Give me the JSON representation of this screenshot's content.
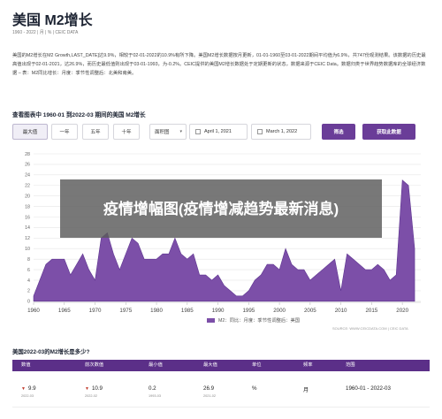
{
  "title": "美国 M2增长",
  "subtitle": "1960 - 2022 | 月 | % | CEIC DATA",
  "description": "美国的M2增长在M2 Growth,LAST_DATE]达9.9%，相较于02-01-2022的10.9%有所下降。美国M2增长数据按月更新，01-01-1960至03-01-2022期间平均值为6.9%，共747份观测结果。该数据的历史最高值出现于02-01-2021，达26.9%，而历史最低值则出现于03-01-1993，为-0.2%。CEIC提供的美国M2增长数据处于定期更新的状态，数据来源于CEIC Data。数据归类于世界趋势数据库的全球经济数据 – 表：M2同比增长：月度：季节性调整后：北美和南美。",
  "section_title": "查看图表中 1960-01 到2022-03 期间的美国 M2增长",
  "controls": {
    "buttons": [
      "最大值",
      "一年",
      "五年",
      "十年"
    ],
    "chart_type": "面积图",
    "start_date": "April 1, 2021",
    "end_date": "March 1, 2022",
    "filter_label": "筛选",
    "download_label": "获取此数据"
  },
  "overlay_text": "疫情增幅图(疫情增减趋势最新消息)",
  "legend_label": "M2：同比：月度：季节性调整后：美国",
  "source_text": "SOURCE: WWW.CEICDATA.COM | CEIC DATA",
  "colors": {
    "accent": "#6a3d98",
    "series": "#7c4fa8",
    "header": "#5b2f88",
    "down": "#c0392b"
  },
  "chart_data": {
    "type": "area",
    "x": [
      1960,
      1961,
      1962,
      1963,
      1964,
      1965,
      1966,
      1967,
      1968,
      1969,
      1970,
      1971,
      1972,
      1973,
      1974,
      1975,
      1976,
      1977,
      1978,
      1979,
      1980,
      1981,
      1982,
      1983,
      1984,
      1985,
      1986,
      1987,
      1988,
      1989,
      1990,
      1991,
      1992,
      1993,
      1994,
      1995,
      1996,
      1997,
      1998,
      1999,
      2000,
      2001,
      2002,
      2003,
      2004,
      2005,
      2006,
      2007,
      2008,
      2009,
      2010,
      2011,
      2012,
      2013,
      2014,
      2015,
      2016,
      2017,
      2018,
      2019,
      2020,
      2021,
      2022
    ],
    "series": [
      {
        "name": "M2：同比：月度：季节性调整后：美国",
        "values": [
          1,
          4,
          7,
          8,
          8,
          8,
          5,
          7,
          9,
          6,
          4,
          12,
          13,
          9,
          6,
          9,
          12,
          11,
          8,
          8,
          8,
          9,
          9,
          12,
          9,
          8,
          9,
          5,
          5,
          4,
          5,
          3,
          2,
          1,
          1,
          2,
          4,
          5,
          7,
          7,
          6,
          10,
          7,
          6,
          6,
          4,
          5,
          6,
          7,
          8,
          2,
          9,
          8,
          7,
          6,
          6,
          7,
          6,
          4,
          5,
          23,
          22,
          10
        ]
      }
    ],
    "x_ticks": [
      "1960",
      "1965",
      "1970",
      "1975",
      "1980",
      "1985",
      "1990",
      "1995",
      "2000",
      "2005",
      "2010",
      "2015",
      "2020"
    ],
    "y_ticks": [
      "0",
      "2",
      "4",
      "6",
      "8",
      "10",
      "12",
      "14",
      "16",
      "18",
      "20",
      "22",
      "24",
      "26",
      "28"
    ],
    "ylim": [
      -0.2,
      28
    ],
    "grid": true
  },
  "table": {
    "title": "美国2022-03的M2增长是多少?",
    "headers": [
      "数值",
      "前次数值",
      "最小值",
      "最大值",
      "单位",
      "频率",
      "范围"
    ],
    "row": {
      "value": "9.9",
      "value_date": "2022-03",
      "prev": "10.9",
      "prev_date": "2022-02",
      "min": "0.2",
      "min_date": "1993-03",
      "max": "26.9",
      "max_date": "2021-02",
      "unit": "%",
      "freq": "月",
      "range": "1960-01 - 2022-03"
    }
  }
}
